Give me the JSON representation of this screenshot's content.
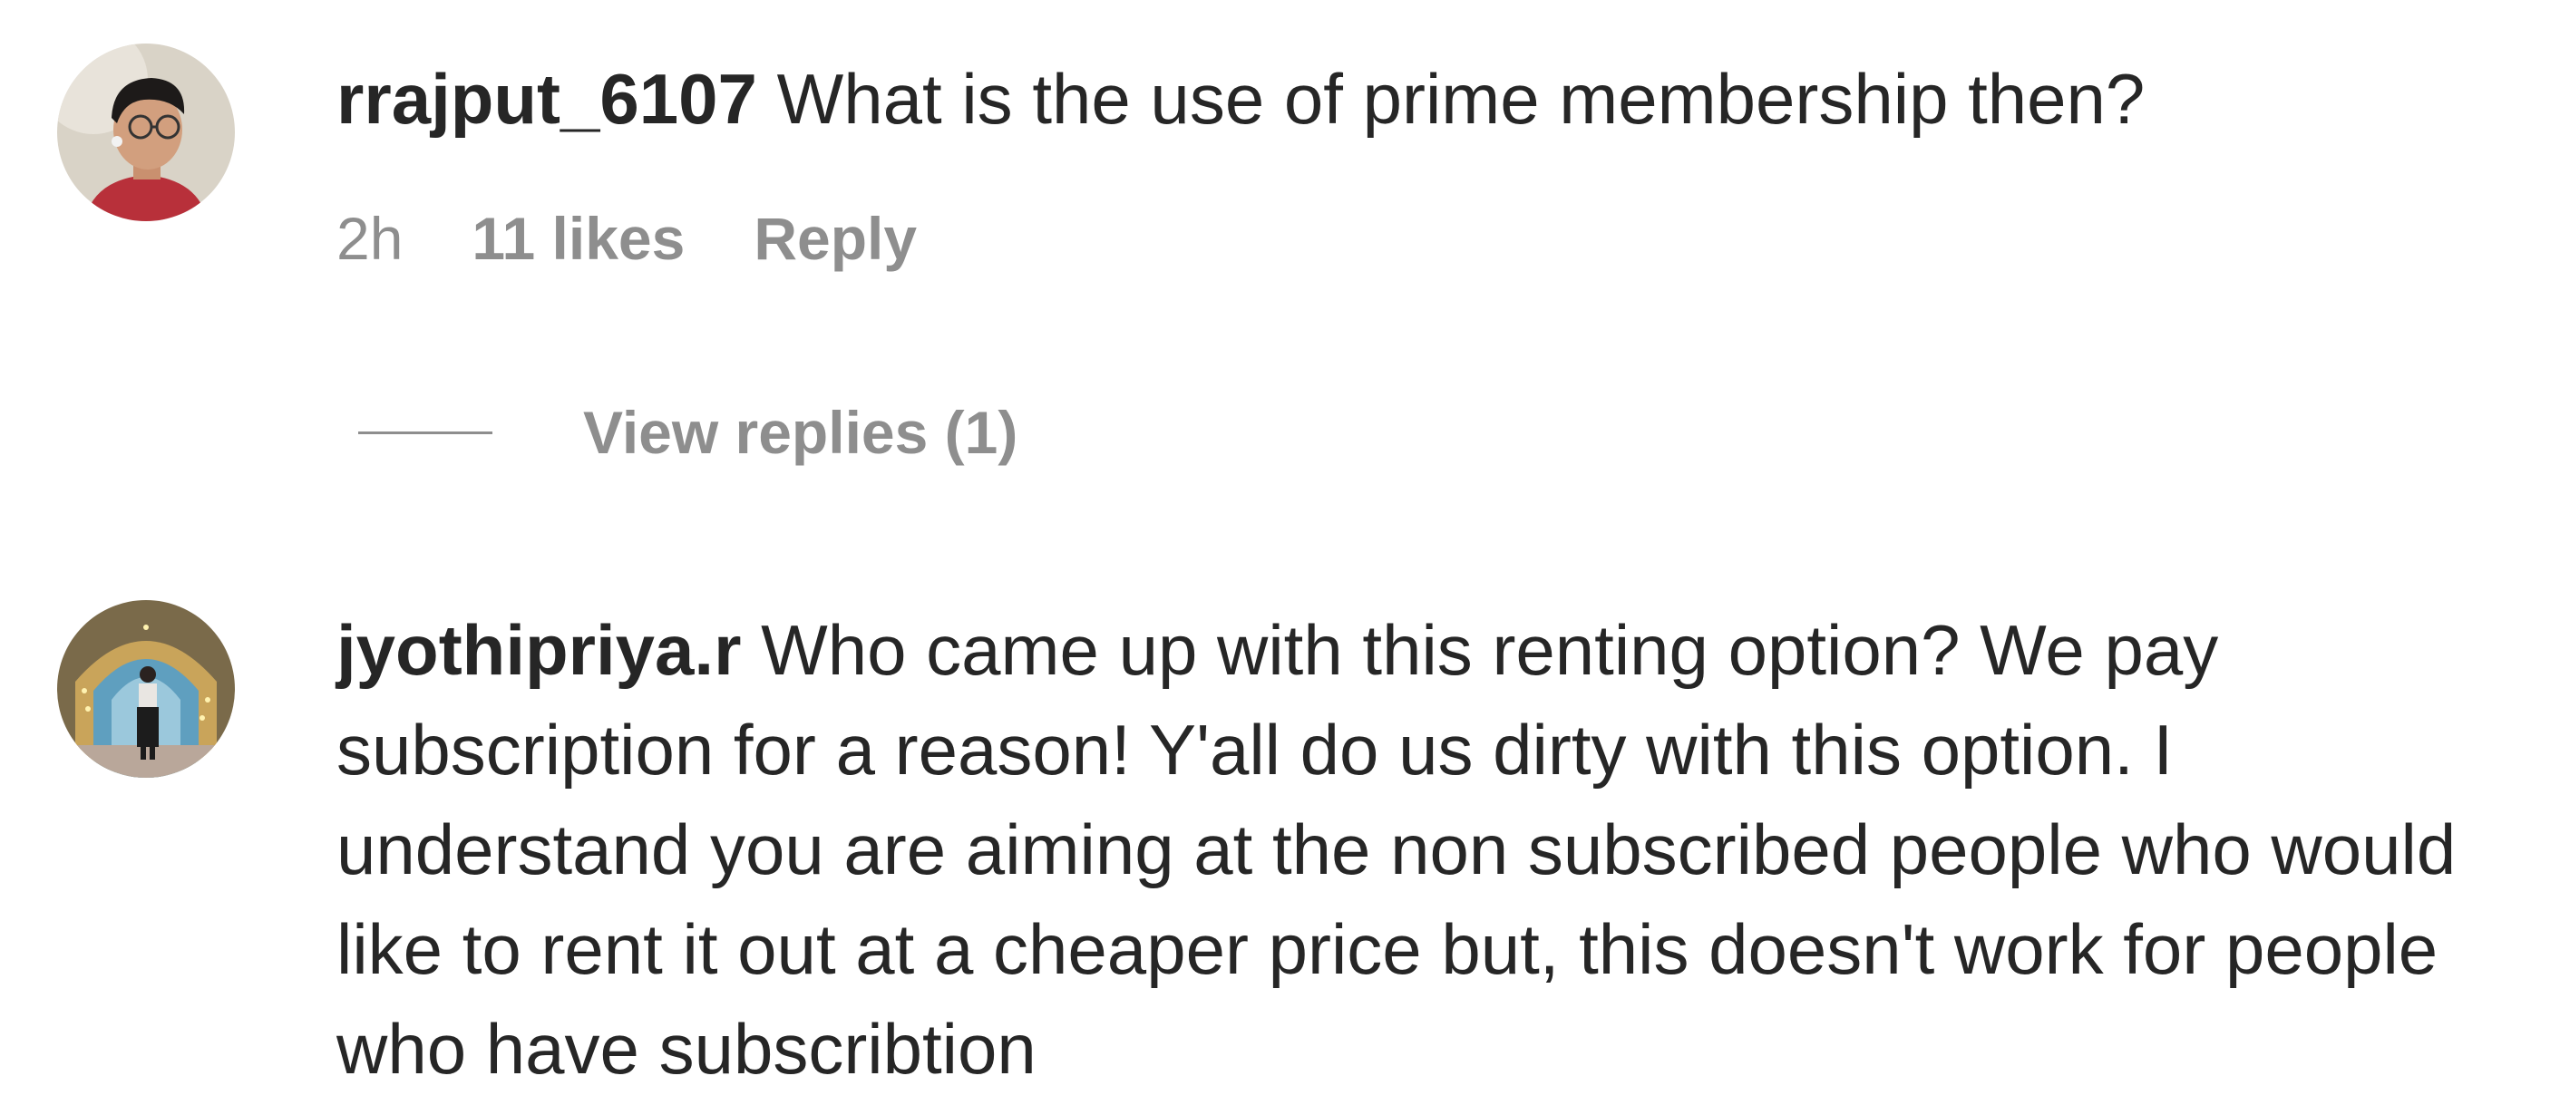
{
  "comments": [
    {
      "username": "rrajput_6107",
      "text": "What is the use of prime membership then?",
      "time": "2h",
      "likes": "11 likes",
      "reply_label": "Reply",
      "view_replies": "View replies (1)",
      "avatar_icon": "user-avatar-photo"
    },
    {
      "username": "jyothipriya.r",
      "text": "Who came up with this renting option? We pay subscription for a reason! Y'all do us dirty with this option. I understand you are aiming at the non subscribed people who would like to rent it out at a cheaper price but, this doesn't work for people who have subscribtion",
      "avatar_icon": "user-avatar-photo"
    }
  ],
  "colors": {
    "text_primary": "#262626",
    "text_secondary": "#8e8e8e",
    "background": "#ffffff"
  }
}
